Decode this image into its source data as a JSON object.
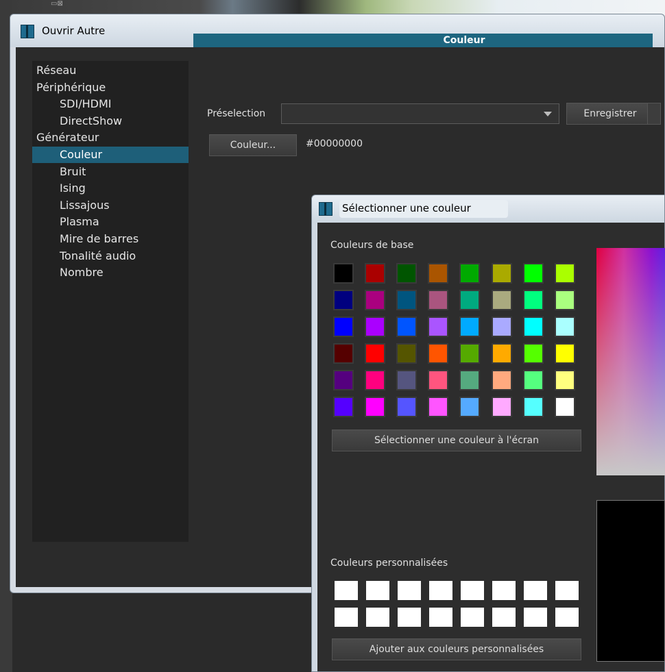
{
  "main_window": {
    "title": "Ouvrir Autre"
  },
  "tree": {
    "items": [
      {
        "label": "Réseau",
        "level": 0,
        "selected": false
      },
      {
        "label": "Périphérique",
        "level": 0,
        "selected": false
      },
      {
        "label": "SDI/HDMI",
        "level": 1,
        "selected": false
      },
      {
        "label": "DirectShow",
        "level": 1,
        "selected": false
      },
      {
        "label": "Générateur",
        "level": 0,
        "selected": false
      },
      {
        "label": "Couleur",
        "level": 1,
        "selected": true
      },
      {
        "label": "Bruit",
        "level": 1,
        "selected": false
      },
      {
        "label": "Ising",
        "level": 1,
        "selected": false
      },
      {
        "label": "Lissajous",
        "level": 1,
        "selected": false
      },
      {
        "label": "Plasma",
        "level": 1,
        "selected": false
      },
      {
        "label": "Mire de barres",
        "level": 1,
        "selected": false
      },
      {
        "label": "Tonalité audio",
        "level": 1,
        "selected": false
      },
      {
        "label": "Nombre",
        "level": 1,
        "selected": false
      }
    ]
  },
  "panel": {
    "header": "Couleur",
    "preset_label": "Préselection",
    "preset_value": "",
    "save_button": "Enregistrer",
    "color_button": "Couleur...",
    "color_value": "#00000000"
  },
  "color_dialog": {
    "title": "Sélectionner une couleur",
    "basic_colors_label": "Couleurs de base",
    "basic_colors": [
      "#000000",
      "#aa0000",
      "#005500",
      "#aa5500",
      "#00aa00",
      "#aaaa00",
      "#00ff00",
      "#aaff00",
      "#00007f",
      "#aa007f",
      "#00557f",
      "#aa557f",
      "#00aa7f",
      "#aaaa7f",
      "#00ff7f",
      "#aaff7f",
      "#0000ff",
      "#aa00ff",
      "#0055ff",
      "#aa55ff",
      "#00aaff",
      "#aaaaff",
      "#00ffff",
      "#aaffff",
      "#550000",
      "#ff0000",
      "#555500",
      "#ff5500",
      "#55aa00",
      "#ffaa00",
      "#55ff00",
      "#ffff00",
      "#55007f",
      "#ff007f",
      "#55557f",
      "#ff557f",
      "#55aa7f",
      "#ffaa7f",
      "#55ff7f",
      "#ffff7f",
      "#5500ff",
      "#ff00ff",
      "#5555ff",
      "#ff55ff",
      "#55aaff",
      "#ffaaff",
      "#55ffff",
      "#ffffff"
    ],
    "pick_screen_button": "Sélectionner une couleur à l'écran",
    "custom_colors_label": "Couleurs personnalisées",
    "custom_colors": [
      "#ffffff",
      "#ffffff",
      "#ffffff",
      "#ffffff",
      "#ffffff",
      "#ffffff",
      "#ffffff",
      "#ffffff",
      "#ffffff",
      "#ffffff",
      "#ffffff",
      "#ffffff",
      "#ffffff",
      "#ffffff",
      "#ffffff",
      "#ffffff"
    ],
    "add_custom_button": "Ajouter aux couleurs personnalisées",
    "current_color": "#000000"
  }
}
